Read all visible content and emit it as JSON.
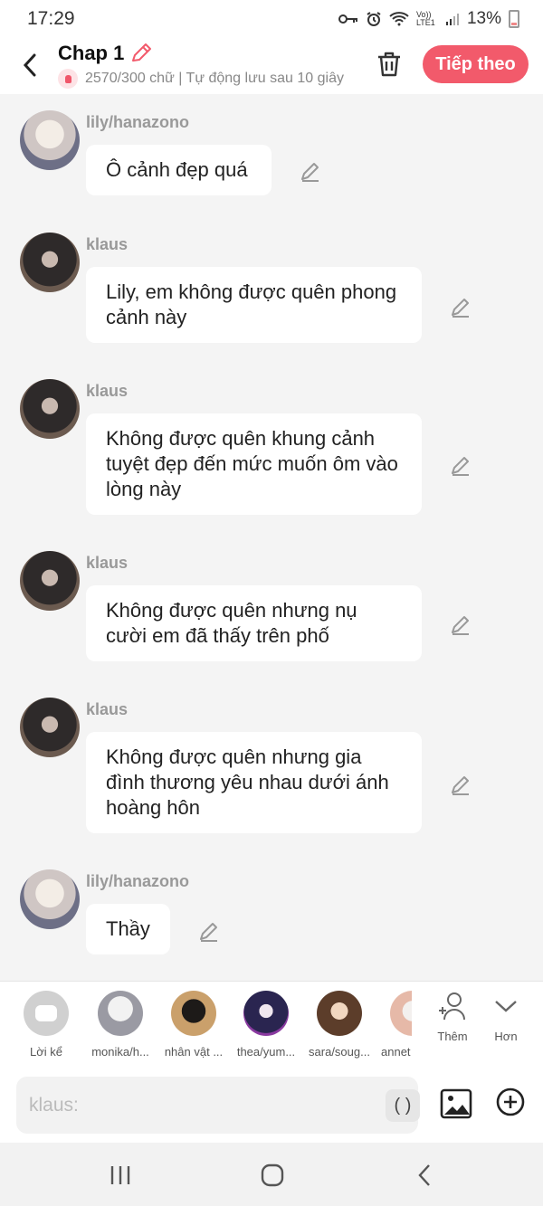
{
  "status": {
    "time": "17:29",
    "network": "Vo)) LTE1",
    "battery": "13%"
  },
  "header": {
    "title": "Chap 1",
    "subtitle": "2570/300 chữ | Tự động lưu sau 10 giây",
    "next_label": "Tiếp theo"
  },
  "messages": [
    {
      "name": "lily/hanazono",
      "text": "Ô cảnh đẹp quá",
      "avatar": "lily"
    },
    {
      "name": "klaus",
      "text": "Lily, em không được quên phong cảnh này",
      "avatar": "klaus"
    },
    {
      "name": "klaus",
      "text": "Không được quên khung cảnh tuyệt đẹp đến mức muốn ôm vào lòng này",
      "avatar": "klaus"
    },
    {
      "name": "klaus",
      "text": "Không được quên nhưng nụ cười em đã thấy trên phố",
      "avatar": "klaus"
    },
    {
      "name": "klaus",
      "text": "Không được quên nhưng gia đình thương yêu nhau dưới ánh hoàng hôn",
      "avatar": "klaus"
    },
    {
      "name": "lily/hanazono",
      "text": "Thầy",
      "avatar": "lily"
    }
  ],
  "characters": [
    {
      "label": "Lời kể"
    },
    {
      "label": "monika/h..."
    },
    {
      "label": "nhân vật ..."
    },
    {
      "label": "thea/yum..."
    },
    {
      "label": "sara/soug..."
    },
    {
      "label": "annet"
    }
  ],
  "actions": {
    "add_label": "Thêm",
    "more_label": "Hơn"
  },
  "input": {
    "placeholder": "klaus:",
    "paren_label": "( )"
  },
  "colors": {
    "accent": "#f25a6b",
    "bubble": "#ffffff",
    "background": "#f4f4f4"
  }
}
